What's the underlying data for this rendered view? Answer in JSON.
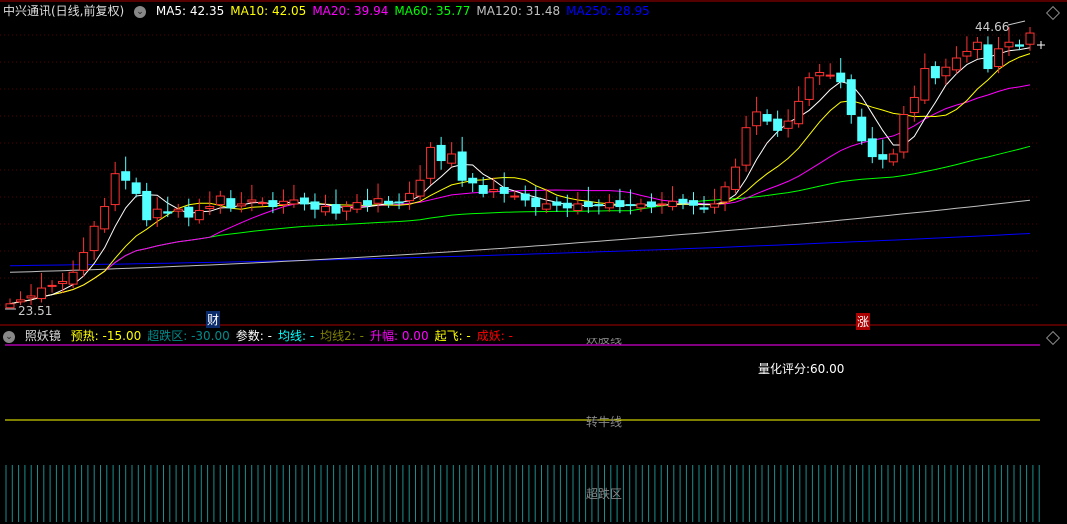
{
  "header": {
    "title": "中兴通讯(日线,前复权)",
    "ma": [
      {
        "label": "MA5: 42.35",
        "color": "#ffffff"
      },
      {
        "label": "MA10: 42.05",
        "color": "#ffff00"
      },
      {
        "label": "MA20: 39.94",
        "color": "#ff00ff"
      },
      {
        "label": "MA60: 35.77",
        "color": "#00ff00"
      },
      {
        "label": "MA120: 31.48",
        "color": "#c0c0c0"
      },
      {
        "label": "MA250: 28.95",
        "color": "#0000ff"
      }
    ]
  },
  "indicator": {
    "title": "照妖镜",
    "items": [
      {
        "label": "预热: -15.00",
        "color": "#ffff00"
      },
      {
        "label": "超跌区: -30.00",
        "color": "#008b8b"
      },
      {
        "label": "参数: -",
        "color": "#ffffff"
      },
      {
        "label": "均线: -",
        "color": "#00ffff"
      },
      {
        "label": "均线2: -",
        "color": "#808000"
      },
      {
        "label": "升幅: 0.00",
        "color": "#ff00ff"
      },
      {
        "label": "起飞: -",
        "color": "#ffff00"
      },
      {
        "label": "成妖: -",
        "color": "#ff0000"
      }
    ],
    "score": "量化评分:60.00",
    "line_top": "妖股线",
    "line_mid": "转牛线",
    "line_bottom": "超跌区"
  },
  "markers": {
    "max": "44.66",
    "min": "23.51",
    "signal1": "财",
    "signal2": "涨"
  },
  "chart_data": {
    "type": "candlestick",
    "ylim": [
      23.51,
      44.66
    ],
    "close": [
      23.6,
      23.9,
      24.2,
      24.8,
      25.0,
      25.3,
      26.0,
      27.5,
      29.5,
      31.0,
      33.5,
      33.0,
      32.0,
      30.0,
      30.8,
      30.5,
      30.8,
      30.2,
      30.7,
      31.0,
      31.8,
      30.9,
      31.2,
      31.5,
      31.3,
      31.0,
      31.4,
      31.5,
      31.2,
      30.8,
      31.0,
      30.5,
      31.0,
      31.3,
      31.1,
      31.6,
      31.2,
      31.3,
      32.0,
      33.0,
      35.5,
      34.5,
      35.0,
      33.0,
      32.8,
      32.0,
      32.3,
      32.0,
      31.8,
      31.5,
      31.0,
      31.2,
      31.1,
      30.9,
      31.2,
      31.0,
      31.1,
      31.3,
      31.0,
      31.1,
      31.2,
      31.0,
      31.2,
      31.4,
      31.3,
      31.1,
      30.8,
      31.2,
      32.5,
      34.0,
      37.0,
      38.2,
      37.5,
      36.8,
      37.5,
      39.0,
      40.8,
      41.2,
      41.0,
      40.5,
      38.0,
      36.0,
      34.8,
      34.6,
      35.0,
      38.0,
      39.3,
      41.5,
      40.8,
      41.6,
      42.3,
      42.8,
      43.5,
      41.5,
      43.0,
      43.5,
      43.2,
      44.2
    ],
    "ma120": [
      26.0,
      31.48
    ],
    "ma250": [
      26.5,
      28.95
    ]
  }
}
